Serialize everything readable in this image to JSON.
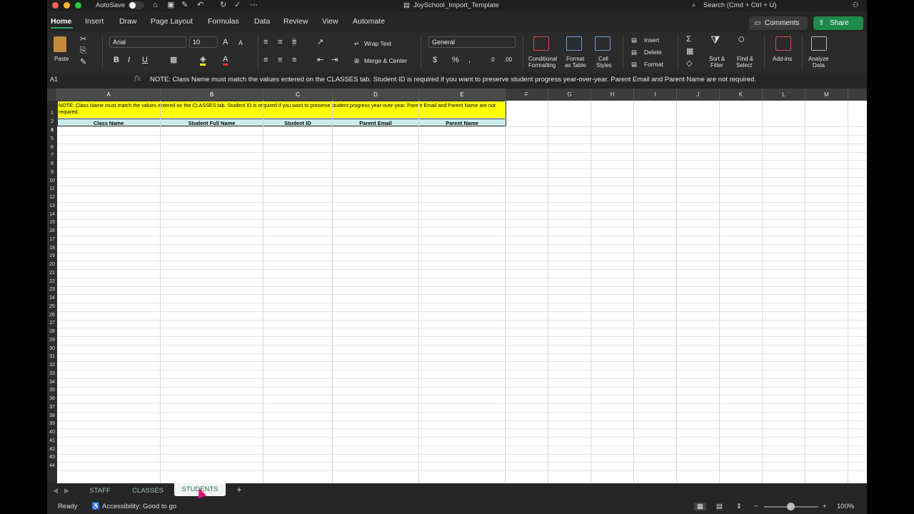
{
  "titlebar": {
    "autosave_label": "AutoSave",
    "document_title": "JoySchool_Import_Template",
    "search_placeholder": "Search (Cmd + Ctrl + U)"
  },
  "ribbon_tabs": [
    "Home",
    "Insert",
    "Draw",
    "Page Layout",
    "Formulas",
    "Data",
    "Review",
    "View",
    "Automate"
  ],
  "header_buttons": {
    "comments": "Comments",
    "share": "Share"
  },
  "ribbon": {
    "paste": "Paste",
    "font_name": "Arial",
    "font_size": "10",
    "bold": "B",
    "italic": "I",
    "underline": "U",
    "wrap_text": "Wrap Text",
    "merge_center": "Merge & Center",
    "number_format": "General",
    "conditional_formatting": [
      "Conditional",
      "Formatting"
    ],
    "format_as_table": [
      "Format",
      "as Table"
    ],
    "cell_styles": [
      "Cell",
      "Styles"
    ],
    "insert": "Insert",
    "delete": "Delete",
    "format": "Format",
    "sort_filter": [
      "Sort &",
      "Filter"
    ],
    "find_select": [
      "Find &",
      "Select"
    ],
    "add_ins": "Add-ins",
    "analyze_data": [
      "Analyze",
      "Data"
    ]
  },
  "formula_bar": {
    "name_box": "A1",
    "fx": "fx",
    "content": "NOTE: Class Name must match the values entered on the CLASSES tab.  Student ID is required if you want to preserve student progress year-over-year.  Parent Email and Parent Name are not required."
  },
  "grid": {
    "columns": [
      "A",
      "B",
      "C",
      "D",
      "E",
      "F",
      "G",
      "H",
      "I",
      "J",
      "K",
      "L",
      "M"
    ],
    "rows_visible": 44,
    "note_text": "NOTE: Class Name must match the values entered on the CLASSES tab.  Student ID is required if you want to preserve student progress year-over-year.  Parent Email and Parent Name are not required.",
    "headers": [
      "Class Name",
      "Student Full Name",
      "Student ID",
      "Parent Email",
      "Parent Name"
    ],
    "note_fill": "#ffff00",
    "header_fill": "#ccecec"
  },
  "sheet_tabs": [
    "STAFF",
    "CLASSES",
    "STUDENTS"
  ],
  "active_sheet": "STUDENTS",
  "add_sheet": "+",
  "status": {
    "ready": "Ready",
    "accessibility": "Accessibility: Good to go",
    "zoom": "100%"
  },
  "colors": {
    "accent": "#1f8a4c",
    "tab_underline": "#2ea15d"
  }
}
